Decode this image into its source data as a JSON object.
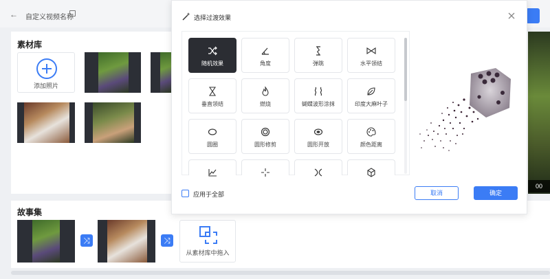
{
  "header": {
    "back_icon": "arrow-left-icon",
    "title": "自定义视频名称",
    "edit_icon": "edit-icon"
  },
  "library": {
    "title": "素材库",
    "add_label": "添加照片",
    "photos": [
      "photo-1",
      "photo-2",
      "photo-3",
      "photo-4"
    ]
  },
  "preview_badge": "00",
  "story": {
    "title": "故事集",
    "drag_label": "从素材库中拖入"
  },
  "modal": {
    "title": "选择过渡效果",
    "apply_all_label": "应用于全部",
    "cancel_label": "取消",
    "confirm_label": "确定",
    "accent_color": "#3b7cf5",
    "effects": [
      {
        "label": "随机效果",
        "icon": "shuffle-icon",
        "selected": true
      },
      {
        "label": "角度",
        "icon": "angle-icon",
        "selected": false
      },
      {
        "label": "弹跳",
        "icon": "spring-icon",
        "selected": false
      },
      {
        "label": "水平领结",
        "icon": "bowtie-horizontal-icon",
        "selected": false
      },
      {
        "label": "垂直领结",
        "icon": "bowtie-vertical-icon",
        "selected": false
      },
      {
        "label": "燃烧",
        "icon": "flame-icon",
        "selected": false
      },
      {
        "label": "蝴蝶波形涂抹",
        "icon": "wave-icon",
        "selected": false
      },
      {
        "label": "印度大麻叶子",
        "icon": "leaf-icon",
        "selected": false
      },
      {
        "label": "圆圈",
        "icon": "ellipse-icon",
        "selected": false
      },
      {
        "label": "圆形修剪",
        "icon": "circle-crop-icon",
        "selected": false
      },
      {
        "label": "圆形开放",
        "icon": "circle-open-icon",
        "selected": false
      },
      {
        "label": "颜色距离",
        "icon": "palette-icon",
        "selected": false
      },
      {
        "label": "",
        "icon": "chart-line-icon",
        "selected": false
      },
      {
        "label": "",
        "icon": "crosshair-icon",
        "selected": false
      },
      {
        "label": "",
        "icon": "cross-curve-icon",
        "selected": false
      },
      {
        "label": "",
        "icon": "cube-icon",
        "selected": false
      }
    ]
  }
}
